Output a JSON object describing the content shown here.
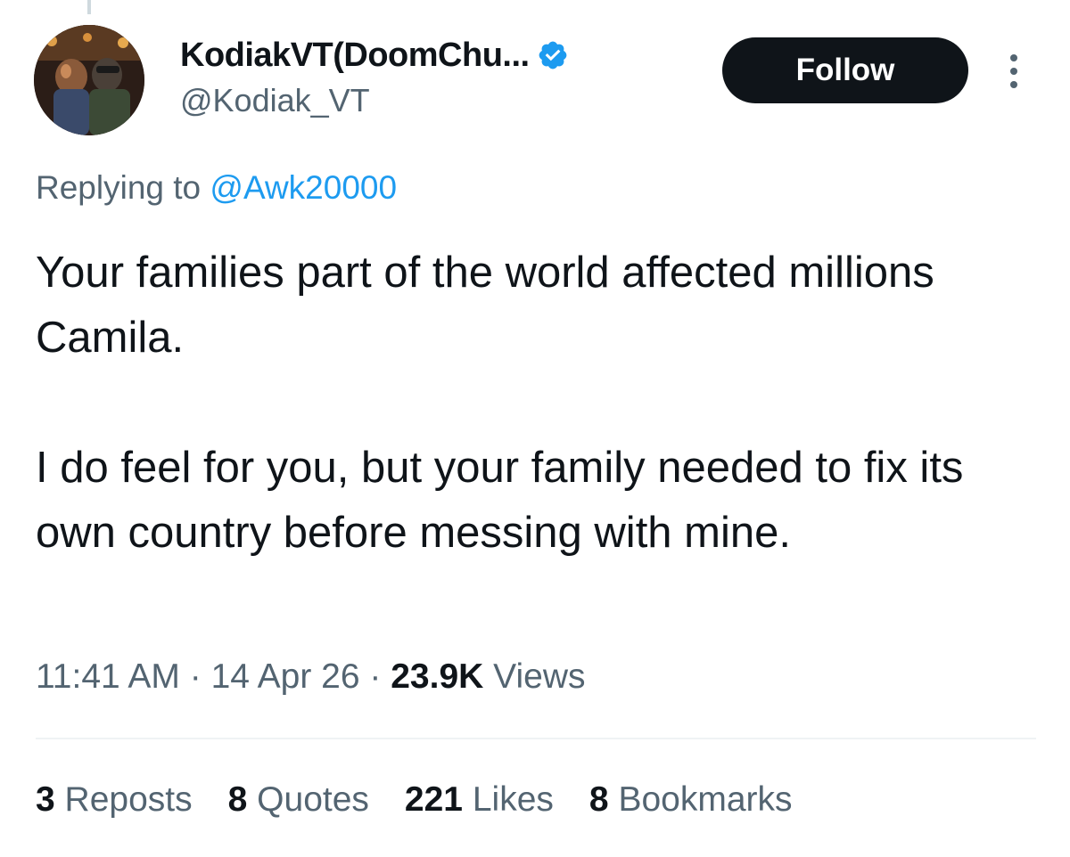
{
  "author": {
    "display_name": "KodiakVT(DoomChu...",
    "handle": "@Kodiak_VT",
    "verified": true
  },
  "follow_button_label": "Follow",
  "reply": {
    "prefix": "Replying to",
    "mention": "@Awk20000"
  },
  "tweet": {
    "paragraph_1": "Your families part of the world affected millions Camila.",
    "paragraph_2": "I do feel for you, but your family needed to fix its own country before messing with mine."
  },
  "meta": {
    "time": "11:41 AM",
    "separator": "·",
    "date": "14 Apr 26",
    "views_count": "23.9K",
    "views_label": "Views"
  },
  "stats": {
    "reposts_count": "3",
    "reposts_label": "Reposts",
    "quotes_count": "8",
    "quotes_label": "Quotes",
    "likes_count": "221",
    "likes_label": "Likes",
    "bookmarks_count": "8",
    "bookmarks_label": "Bookmarks"
  },
  "colors": {
    "text_primary": "#0f1419",
    "text_secondary": "#536471",
    "accent_blue": "#1d9bf0",
    "divider": "#eff3f4"
  }
}
